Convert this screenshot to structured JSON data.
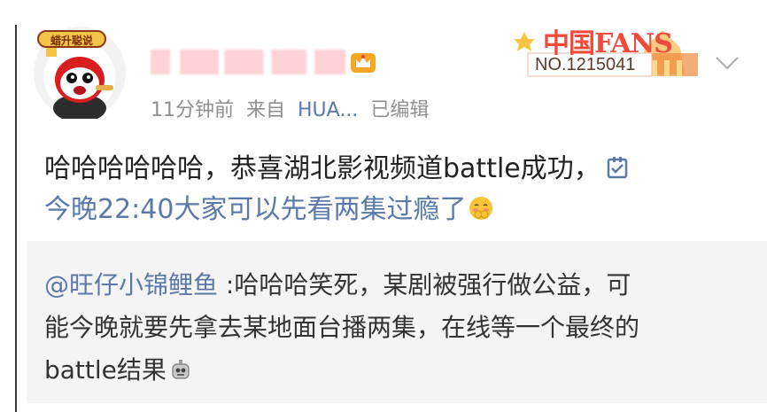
{
  "post": {
    "time": "11分钟前",
    "source_label": "来自",
    "source": "HUA...",
    "edited": "已编辑",
    "fans_badge": {
      "title": "中国FANS",
      "number": "NO.1215041"
    },
    "text_line1": "哈哈哈哈哈哈，恭喜湖北影视频道battle成功，",
    "text_line2_link": "今晚22:40大家可以先看两集过瘾了",
    "avatar_badge": "蜡升聪说"
  },
  "quote": {
    "mention": "@旺仔小锦鲤鱼",
    "line1_rest": " :哈哈哈笑死，某剧被强行做公益，可",
    "line2": "能今晚就要先拿去某地面台播两集，在线等一个最终的",
    "line3": "battle结果"
  },
  "colors": {
    "link": "#5a79a9",
    "meta": "#8f8f8f",
    "quote_bg": "#f4f4f4",
    "badge_red": "#f04a3a"
  },
  "icons": {
    "vip": "crown-vip-icon",
    "more": "chevron-down-icon",
    "edit": "edit-checkbox-icon",
    "emoji": "shy-face-emoji-icon",
    "robot": "robot-emoji-icon"
  }
}
